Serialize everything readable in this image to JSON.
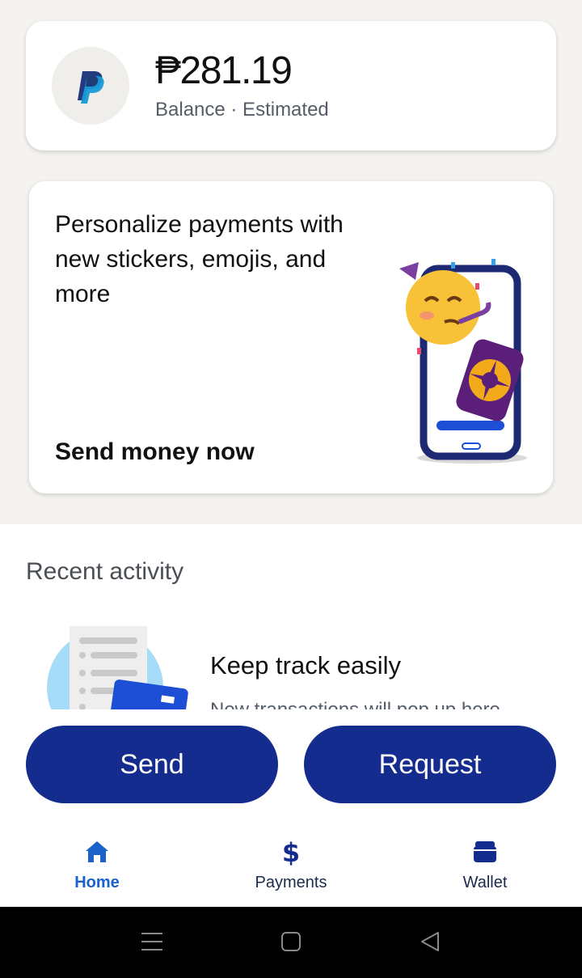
{
  "balance": {
    "amount": "₱281.19",
    "caption": "Balance · Estimated",
    "logo_icon": "paypal-logo"
  },
  "promo": {
    "text": "Personalize payments with new stickers, emojis, and more",
    "link": "Send money now",
    "art_icon": "party-emoji-phone-illustration"
  },
  "recent_activity": {
    "title": "Recent activity",
    "empty_title": "Keep track easily",
    "empty_subtitle": "New transactions will pop up here"
  },
  "actions": {
    "send": "Send",
    "request": "Request"
  },
  "tabs": [
    {
      "label": "Home",
      "icon": "home-icon",
      "active": true
    },
    {
      "label": "Payments",
      "icon": "dollar-icon",
      "active": false
    },
    {
      "label": "Wallet",
      "icon": "wallet-icon",
      "active": false
    }
  ],
  "system_nav": [
    "menu-icon",
    "home-square-icon",
    "back-triangle-icon"
  ],
  "colors": {
    "primary_button": "#142c8e",
    "active_tab": "#1a61c9",
    "page_background": "#f5f3f0"
  }
}
